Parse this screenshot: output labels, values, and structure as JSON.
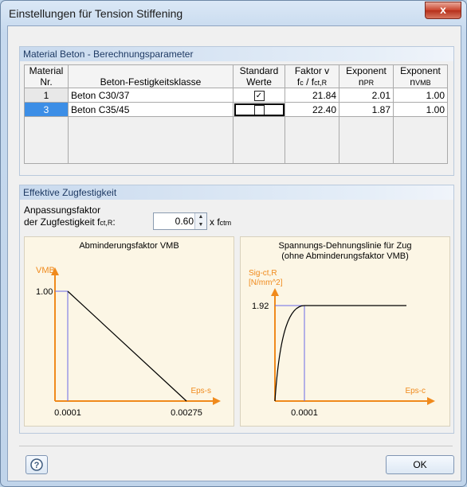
{
  "window": {
    "title": "Einstellungen für Tension Stiffening",
    "close_glyph": "x"
  },
  "material_panel": {
    "header": "Material Beton - Berechnungsparameter",
    "columns": {
      "nr_line1": "Material",
      "nr_line2": "Nr.",
      "class": "Beton-Festigkeitsklasse",
      "std_line1": "Standard",
      "std_line2": "Werte",
      "faktor_line1": "Faktor v",
      "faktor_line2_a": "f",
      "faktor_line2_sub1": "c",
      "faktor_line2_b": " / f",
      "faktor_line2_sub2": "ct,R",
      "npr_line1": "Exponent",
      "npr_line2": "n",
      "npr_sub": "PR",
      "nvmb_line1": "Exponent",
      "nvmb_line2": "n",
      "nvmb_sub": "VMB"
    },
    "rows": [
      {
        "nr": "1",
        "class": "Beton C30/37",
        "standard_checked": true,
        "faktor": "21.84",
        "npr": "2.01",
        "nvmb": "1.00"
      },
      {
        "nr": "3",
        "class": "Beton C35/45",
        "standard_checked": false,
        "faktor": "22.40",
        "npr": "1.87",
        "nvmb": "1.00"
      }
    ]
  },
  "effective_panel": {
    "header": "Effektive Zugfestigkeit",
    "label_line1": "Anpassungsfaktor",
    "label_line2": "der Zugfestigkeit f",
    "label_sub": "ct,R",
    "label_colon": ":",
    "spinner_value": "0.60",
    "unit_prefix": "x f",
    "unit_sub": "ctm"
  },
  "chart_data": [
    {
      "type": "line",
      "title": "Abminderungsfaktor VMB",
      "ylabel": "VMB",
      "xlabel": "Eps-s",
      "y_tick": "1.00",
      "x_ticks": [
        "0.0001",
        "0.00275"
      ],
      "x": [
        0.0001,
        0.00275
      ],
      "y": [
        1.0,
        0.0
      ]
    },
    {
      "type": "line",
      "title_line1": "Spannungs-Dehnungslinie für Zug",
      "title_line2": "(ohne Abminderungsfaktor VMB)",
      "ylabel_line1": "Sig-ct,R",
      "ylabel_line2": "[N/mm^2]",
      "xlabel": "Eps-c",
      "y_tick": "1.92",
      "x_ticks": [
        "0.0001"
      ],
      "x": [
        0,
        0.0001,
        0.0003
      ],
      "y": [
        0,
        1.92,
        1.92
      ]
    }
  ],
  "colors": {
    "axis": "#f08a1c",
    "guide": "#6a6ae6",
    "curve": "#000000",
    "chart_bg": "#fcf6e5",
    "selection": "#3c8ee6"
  },
  "footer": {
    "help_icon": "help-icon",
    "ok_label": "OK"
  }
}
